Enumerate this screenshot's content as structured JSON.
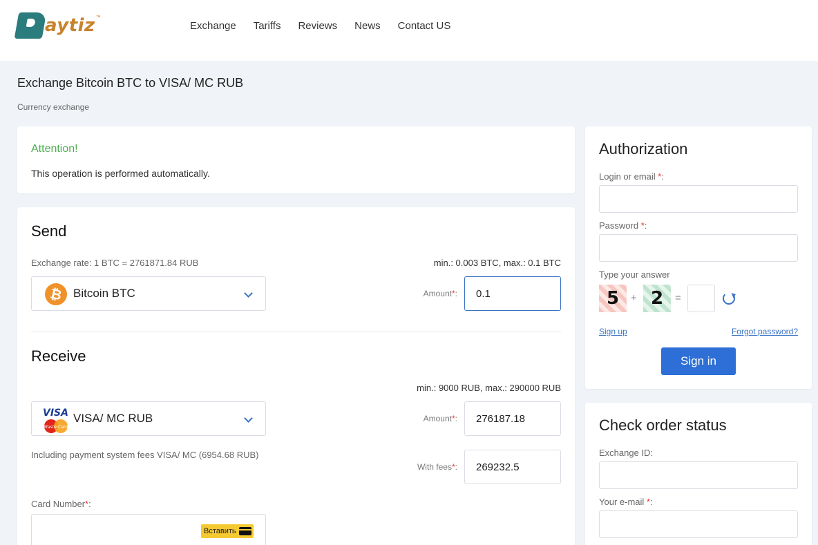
{
  "header": {
    "logo_text": "aytiz",
    "logo_tm": "™",
    "nav": [
      "Exchange",
      "Tariffs",
      "Reviews",
      "News",
      "Contact US"
    ]
  },
  "page": {
    "title": "Exchange Bitcoin BTC to VISA/ MC RUB",
    "breadcrumb": "Currency exchange"
  },
  "attention": {
    "title": "Attention!",
    "text": "This operation is performed automatically."
  },
  "send": {
    "title": "Send",
    "rate": "Exchange rate: 1 BTC = 2761871.84 RUB",
    "limits": "min.: 0.003 BTC, max.: 0.1 BTC",
    "currency": "Bitcoin BTC",
    "currency_icon": "bitcoin-icon",
    "amount_label": "Amount",
    "amount_value": "0.1"
  },
  "receive": {
    "title": "Receive",
    "limits": "min.: 9000 RUB, max.: 290000 RUB",
    "currency": "VISA/ MC RUB",
    "currency_icon": "visa-mastercard-icon",
    "amount_label": "Amount",
    "amount_value": "276187.18",
    "fees_note": "Including payment system fees VISA/ MC (6954.68 RUB)",
    "fees_label": "With fees",
    "fees_value": "269232.5",
    "card_number_label": "Card Number",
    "paste_label": "Вставить"
  },
  "auth": {
    "title": "Authorization",
    "login_label": "Login or email",
    "password_label": "Password",
    "captcha_label": "Type your answer",
    "captcha_a": "5",
    "captcha_op": "+",
    "captcha_b": "2",
    "captcha_eq": "=",
    "signup": "Sign up",
    "forgot": "Forgot password?",
    "signin": "Sign in"
  },
  "order_status": {
    "title": "Check order status",
    "exchange_id_label": "Exchange ID:",
    "email_label": "Your e-mail"
  },
  "colors": {
    "accent": "#2d6fd6",
    "attention": "#4caf50",
    "logo_teal": "#2a7c7d",
    "logo_orange": "#c8822c",
    "required": "#e53935"
  }
}
